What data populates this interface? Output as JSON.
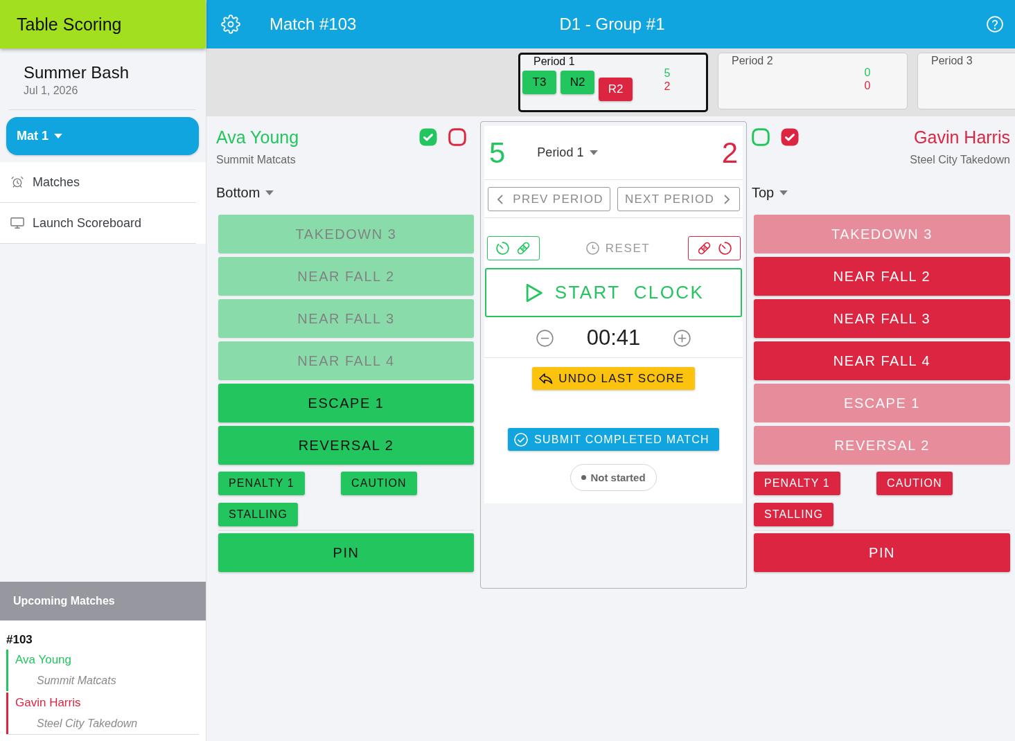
{
  "sidebar": {
    "title": "Table Scoring",
    "event": {
      "name": "Summer Bash",
      "date": "Jul 1, 2026"
    },
    "mat_selector": {
      "label": "Mat 1"
    },
    "nav_items": [
      {
        "label": "Matches"
      },
      {
        "label": "Launch Scoreboard"
      }
    ],
    "upcoming": {
      "title": "Upcoming Matches",
      "matches": [
        {
          "number": "#103",
          "wrestlers": [
            {
              "name": "Ava Young",
              "team": "Summit Matcats",
              "color": "#22c55e"
            },
            {
              "name": "Gavin Harris",
              "team": "Steel City Takedown",
              "color": "#dc2641"
            }
          ]
        }
      ]
    }
  },
  "header": {
    "title": "Match #103",
    "subtitle": "D1 - Group #1"
  },
  "periods": [
    {
      "label": "Period 1",
      "selected": true,
      "scores": [
        {
          "value": "5",
          "chips": [
            "T3",
            "N2"
          ]
        },
        {
          "value": "2",
          "chips": [
            "R2"
          ]
        }
      ]
    },
    {
      "label": "Period 2",
      "selected": false,
      "scores": [
        {
          "value": "0"
        },
        {
          "value": "0"
        }
      ]
    },
    {
      "label": "Period 3",
      "selected": false
    }
  ],
  "wrestlers": [
    {
      "name": "Ava Young",
      "team": "Summit Matcats",
      "color": "#22c55e",
      "checkboxes": [
        {
          "checked": true,
          "color": "#22c55e"
        },
        {
          "checked": false,
          "color": "#dc2641"
        }
      ],
      "position": "Bottom",
      "score_buttons": [
        {
          "label": "TAKEDOWN 3",
          "disabled": true
        },
        {
          "label": "NEAR FALL 2",
          "disabled": true
        },
        {
          "label": "NEAR FALL 3",
          "disabled": true
        },
        {
          "label": "NEAR FALL 4",
          "disabled": true
        },
        {
          "label": "ESCAPE 1",
          "disabled": false
        },
        {
          "label": "REVERSAL 2",
          "disabled": false
        }
      ],
      "penalty_buttons": [
        "PENALTY 1",
        "CAUTION",
        "STALLING"
      ],
      "pin_button": "PIN"
    },
    {
      "name": "Gavin Harris",
      "team": "Steel City Takedown",
      "color": "#dc2641",
      "checkboxes": [
        {
          "checked": false,
          "color": "#22c55e"
        },
        {
          "checked": true,
          "color": "#dc2641"
        }
      ],
      "position": "Top",
      "score_buttons": [
        {
          "label": "TAKEDOWN 3",
          "disabled": true
        },
        {
          "label": "NEAR FALL 2",
          "disabled": false
        },
        {
          "label": "NEAR FALL 3",
          "disabled": false
        },
        {
          "label": "NEAR FALL 4",
          "disabled": false
        },
        {
          "label": "ESCAPE 1",
          "disabled": true
        },
        {
          "label": "REVERSAL 2",
          "disabled": true
        }
      ],
      "penalty_buttons": [
        "PENALTY 1",
        "CAUTION",
        "STALLING"
      ],
      "pin_button": "PIN"
    }
  ],
  "center": {
    "scores": [
      "5",
      "2"
    ],
    "period_select": "Period 1",
    "prev_button": "PREV PERIOD",
    "next_button": "NEXT PERIOD",
    "reset_button": "RESET",
    "start_button": "START CLOCK",
    "time": "00:41",
    "undo_button": "UNDO LAST SCORE",
    "submit_button": "SUBMIT COMPLETED MATCH",
    "status": "Not started"
  }
}
